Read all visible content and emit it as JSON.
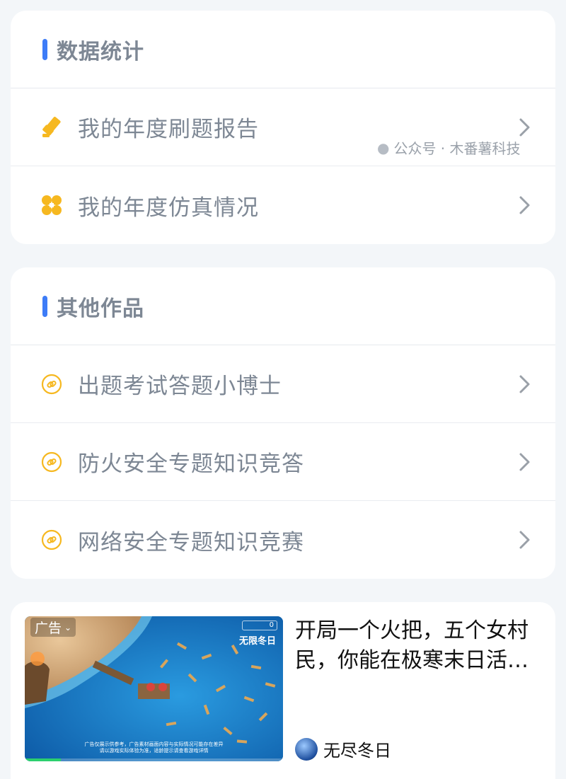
{
  "stats_section": {
    "title": "数据统计",
    "items": [
      {
        "label": "我的年度刷题报告",
        "icon": "brush-icon"
      },
      {
        "label": "我的年度仿真情况",
        "icon": "grid-dots-icon"
      }
    ]
  },
  "works_section": {
    "title": "其他作品",
    "items": [
      {
        "label": "出题考试答题小博士",
        "icon": "link-icon"
      },
      {
        "label": "防火安全专题知识竞答",
        "icon": "link-icon"
      },
      {
        "label": "网络安全专题知识竞赛",
        "icon": "link-icon"
      }
    ]
  },
  "ad": {
    "badge": "广告",
    "game_logo": "无限冬日",
    "counter": "0",
    "caption_line1": "广告仅展示供参考，广告素材画面内容与实际情况可能存在差异",
    "caption_line2": "请以游戏实际体验为准，适龄提示请查看游戏详情",
    "title": "开局一个火把，五个女村民，你能在极寒末日活…",
    "advertiser": "无尽冬日",
    "progress": 0.14
  },
  "watermark": "公众号 · 木番薯科技",
  "colors": {
    "accent": "#3d7cf7",
    "icon_yellow": "#f6b820",
    "text_gray": "#7d8794",
    "chevron": "#9aa0a8"
  }
}
